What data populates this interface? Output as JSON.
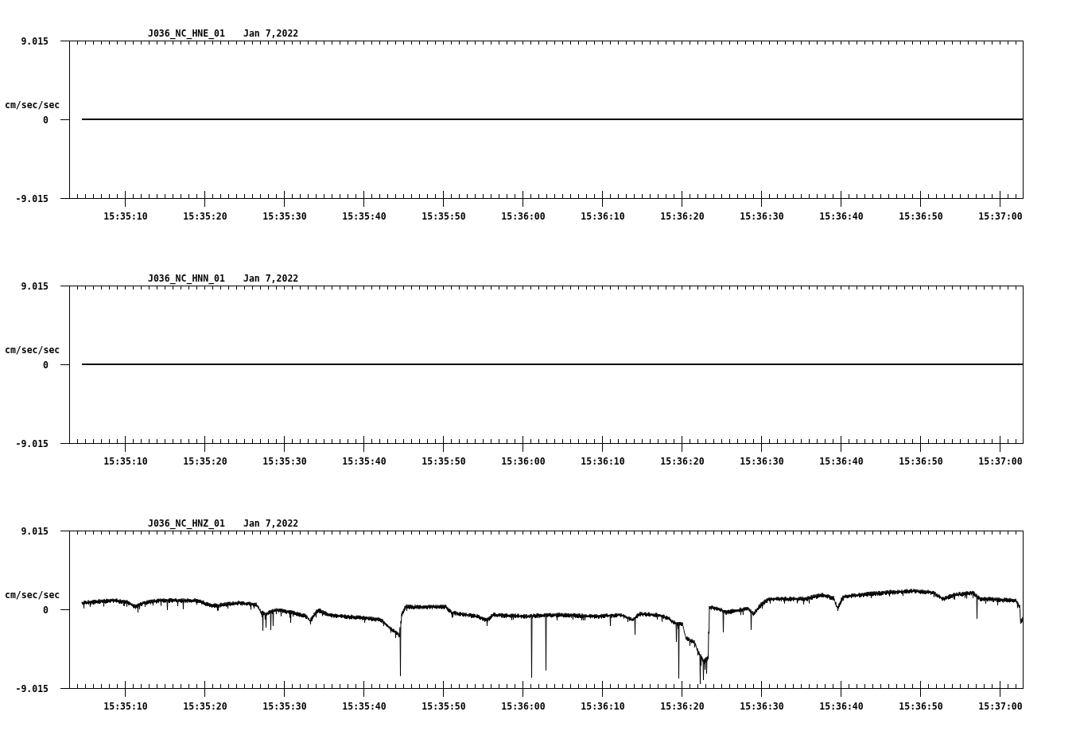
{
  "panels": [
    {
      "channel": "J036_NC_HNE_01",
      "date": "Jan 7,2022",
      "y_unit": "cm/sec/sec",
      "y_ticks": [
        "9.015",
        "0",
        "-9.015"
      ],
      "x_ticks": [
        "15:35:10",
        "15:35:20",
        "15:35:30",
        "15:35:40",
        "15:35:50",
        "15:36:00",
        "15:36:10",
        "15:36:20",
        "15:36:30",
        "15:36:40",
        "15:36:50",
        "15:37:00"
      ],
      "trace": {
        "kind": "flat"
      }
    },
    {
      "channel": "J036_NC_HNN_01",
      "date": "Jan 7,2022",
      "y_unit": "cm/sec/sec",
      "y_ticks": [
        "9.015",
        "0",
        "-9.015"
      ],
      "x_ticks": [
        "15:35:10",
        "15:35:20",
        "15:35:30",
        "15:35:40",
        "15:35:50",
        "15:36:00",
        "15:36:10",
        "15:36:20",
        "15:36:30",
        "15:36:40",
        "15:36:50",
        "15:37:00"
      ],
      "trace": {
        "kind": "flat"
      }
    },
    {
      "channel": "J036_NC_HNZ_01",
      "date": "Jan 7,2022",
      "y_unit": "cm/sec/sec",
      "y_ticks": [
        "9.015",
        "0",
        "-9.015"
      ],
      "x_ticks": [
        "15:35:10",
        "15:35:20",
        "15:35:30",
        "15:35:40",
        "15:35:50",
        "15:36:00",
        "15:36:10",
        "15:36:20",
        "15:36:30",
        "15:36:40",
        "15:36:50",
        "15:37:00"
      ],
      "trace": {
        "kind": "waveform"
      }
    }
  ]
}
